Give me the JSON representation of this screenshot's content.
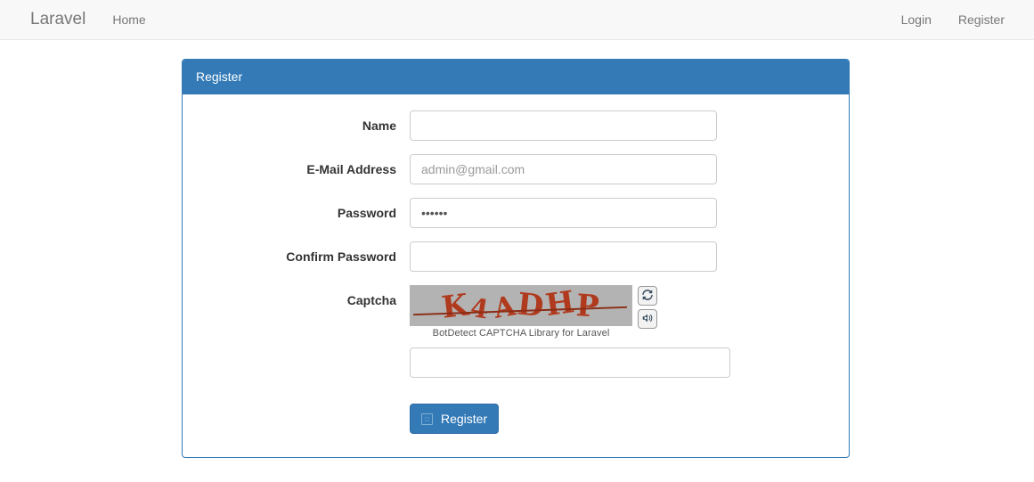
{
  "navbar": {
    "brand": "Laravel",
    "left_links": [
      {
        "label": "Home",
        "name": "nav-link-home"
      }
    ],
    "right_links": [
      {
        "label": "Login",
        "name": "nav-link-login"
      },
      {
        "label": "Register",
        "name": "nav-link-register"
      }
    ],
    "background": "#f8f8f8",
    "text_color": "#777777"
  },
  "panel": {
    "heading": "Register",
    "accent_color": "#337ab7"
  },
  "form": {
    "fields": [
      {
        "label": "Name",
        "name": "name",
        "type": "text",
        "value": "",
        "placeholder": ""
      },
      {
        "label": "E-Mail Address",
        "name": "email",
        "type": "text",
        "value": "",
        "placeholder": "admin@gmail.com"
      },
      {
        "label": "Password",
        "name": "password",
        "type": "password",
        "value": "••••••",
        "placeholder": ""
      },
      {
        "label": "Confirm Password",
        "name": "password-confirm",
        "type": "password",
        "value": "",
        "placeholder": ""
      }
    ],
    "captcha": {
      "label": "Captcha",
      "code": "K4ADHP",
      "characters": [
        "K",
        "4",
        "A",
        "D",
        "H",
        "P"
      ],
      "caption": "BotDetect CAPTCHA Library for Laravel",
      "image_background": "#b3b3b3",
      "text_color": "#b03a1e",
      "reload_icon": "refresh-icon",
      "sound_icon": "speaker-icon",
      "answer_value": "",
      "answer_placeholder": ""
    },
    "submit": {
      "label": "Register",
      "icon": "missing-glyph-icon",
      "icon_glyph": "□"
    }
  }
}
